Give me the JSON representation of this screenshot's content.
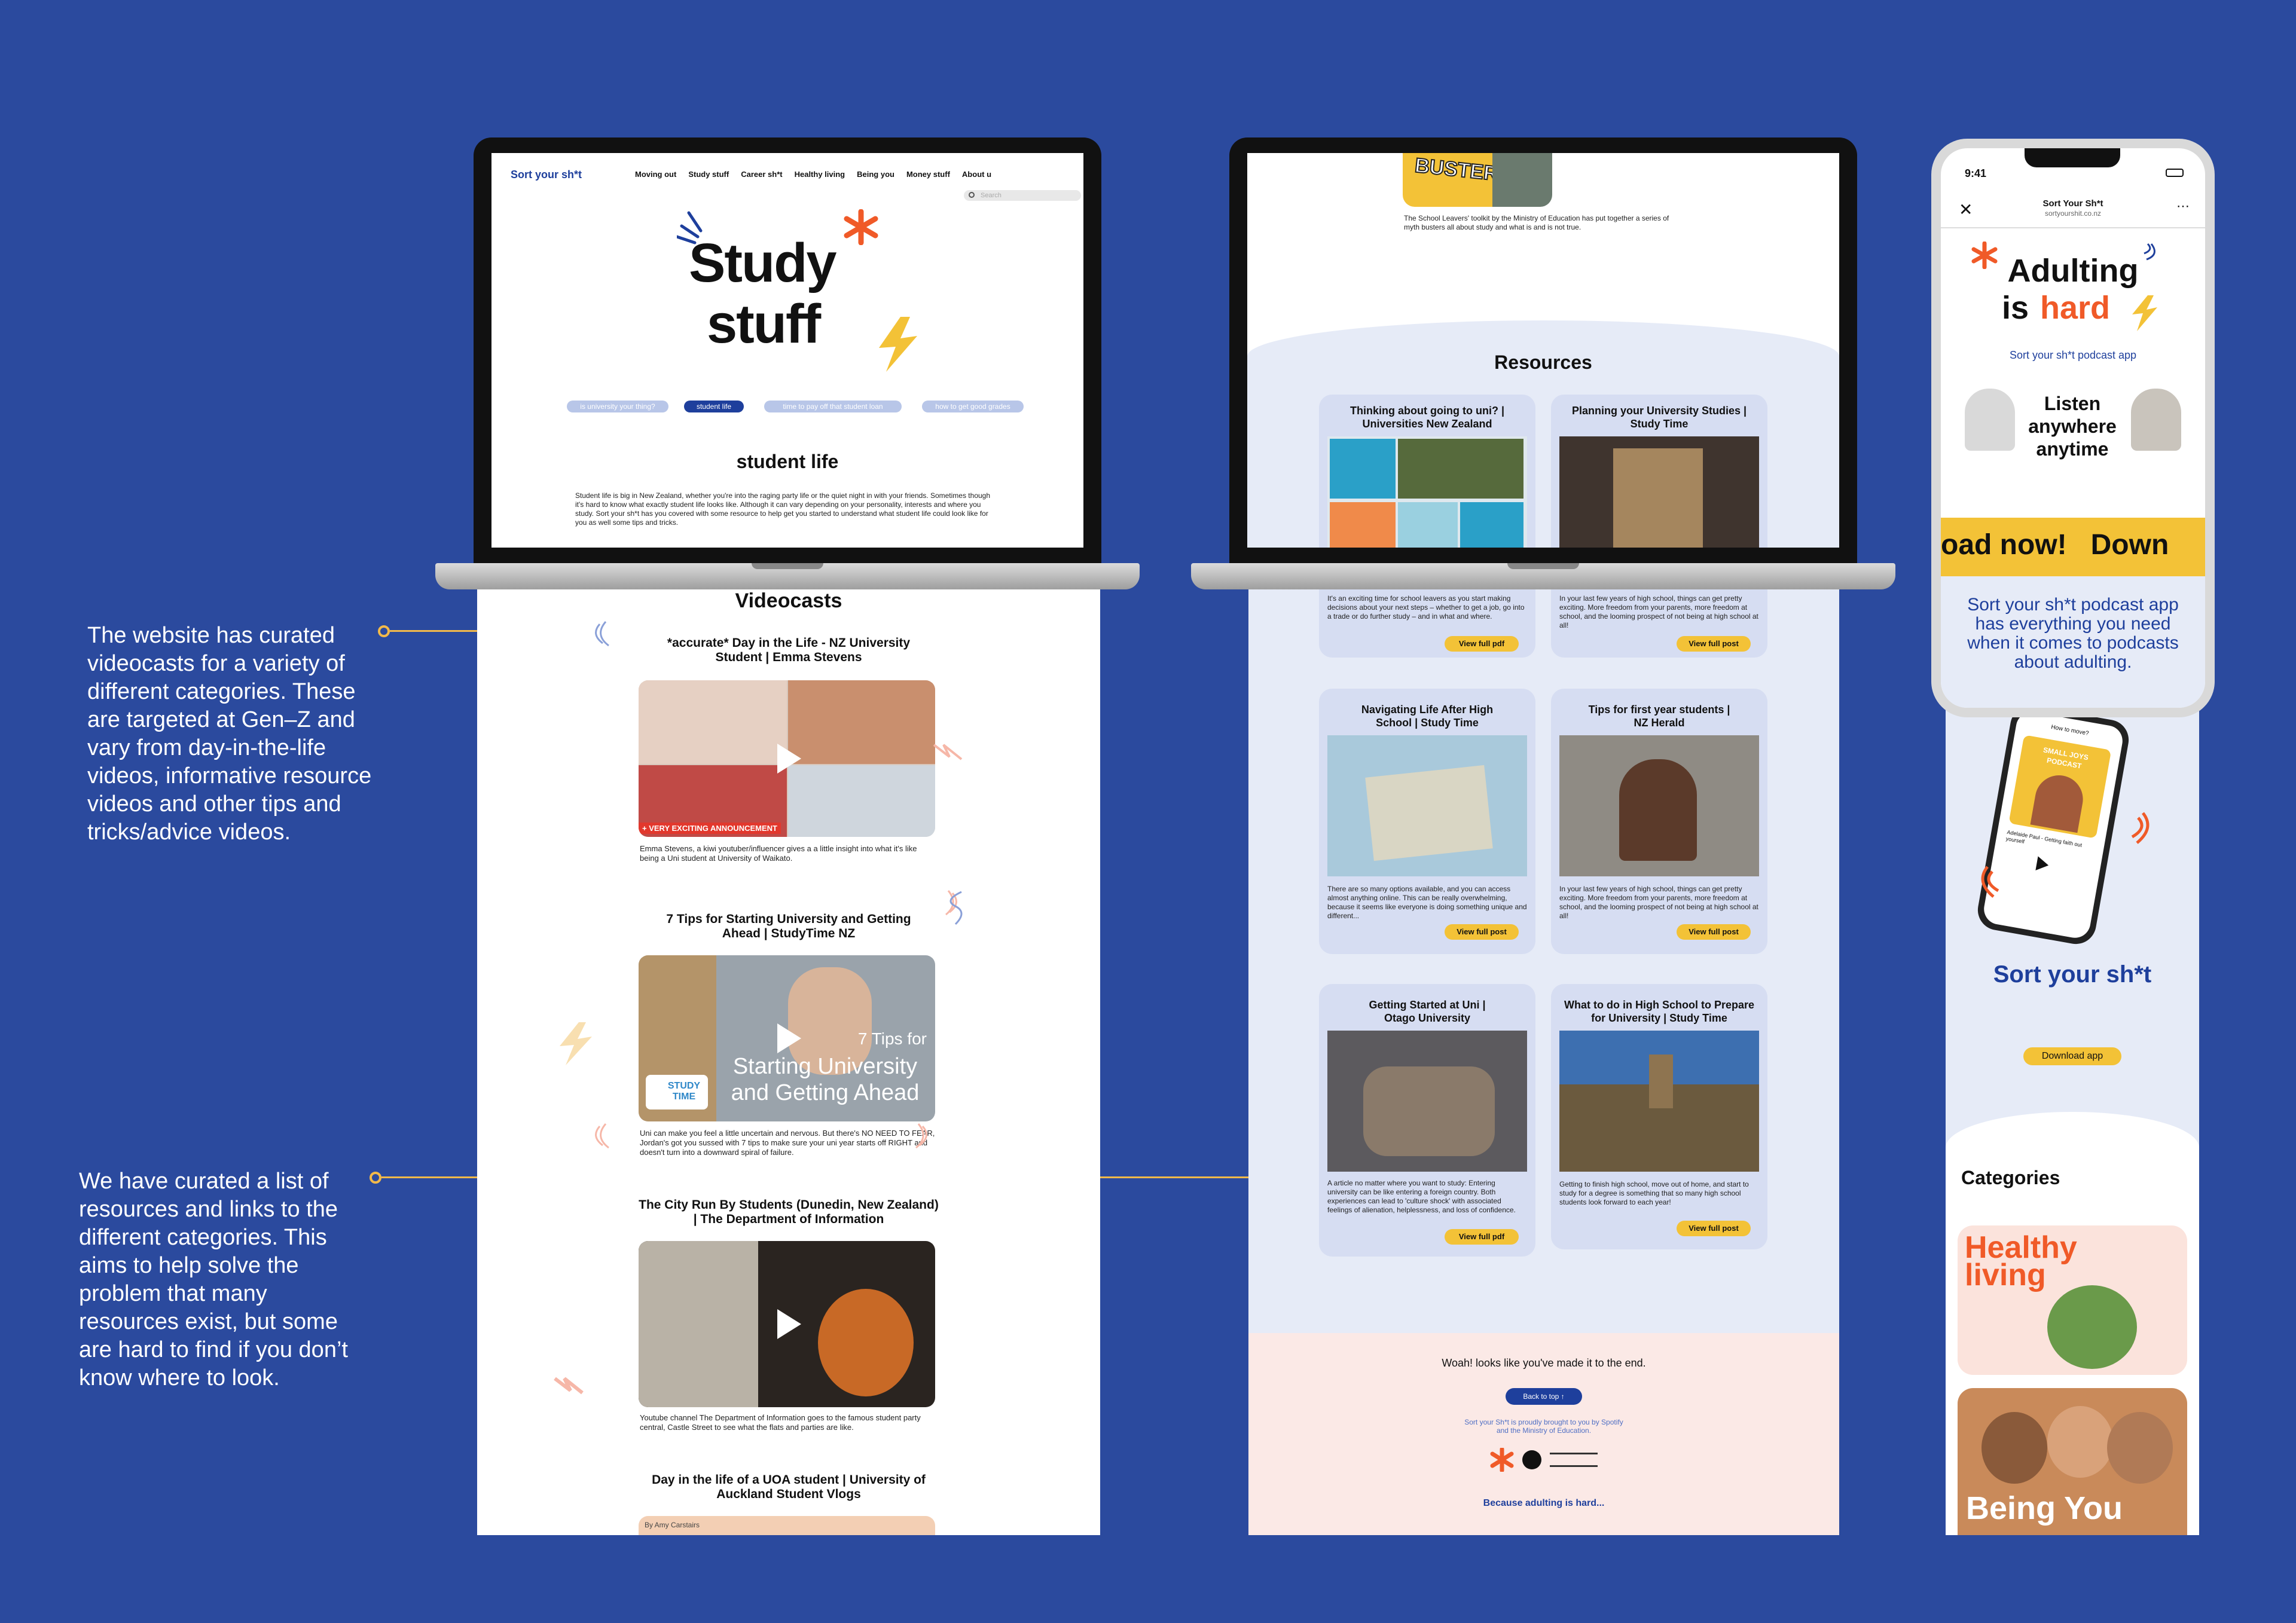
{
  "callouts": {
    "top": "The website has curated videocasts for a variety of different categories. These are targeted at Gen–Z and vary from day-in-the-life videos, informative resource videos and other tips and tricks/advice videos.",
    "bottom": "We have curated a list of resources and links to the different categories. This aims to help solve the problem that many resources exist, but some are hard to find if you don’t know where to look."
  },
  "site1": {
    "logo": "Sort your sh*t",
    "nav": [
      "Moving out",
      "Study stuff",
      "Career sh*t",
      "Healthy living",
      "Being you",
      "Money stuff",
      "About u"
    ],
    "search_placeholder": "Search",
    "hero_line1": "Study",
    "hero_line2": "stuff",
    "pills": [
      "is university your thing?",
      "student life",
      "time to pay off that student loan",
      "how to get good grades"
    ],
    "section_title": "student life",
    "intro": "Student life is big in New Zealand, whether you're into the raging party life or the quiet night in with your friends. Sometimes though it's hard to know what exactly student life looks like. Although it can vary depending on your personality, interests and where you study. Sort your sh*t has you covered with some resource to help get you started to understand what student life could look like for you as well some tips and tricks.",
    "videocasts_title": "Videocasts",
    "videos": [
      {
        "title": "*accurate* Day in the Life - NZ University Student | Emma Stevens",
        "badge": "+ VERY EXCITING ANNOUNCEMENT",
        "desc": "Emma Stevens, a kiwi youtuber/influencer gives a a little insight into what it's like being a Uni student at University of Waikato."
      },
      {
        "title": "7 Tips for Starting University and Getting Ahead | StudyTime NZ",
        "overlay_small": "7 Tips for",
        "overlay_big": "Starting University and Getting Ahead",
        "brand": "STUDY TIME",
        "desc": "Uni can make you feel a little uncertain and nervous. But there's NO NEED TO FEAR, Jordan's got you sussed with 7 tips to make sure your uni year starts off RIGHT and doesn't turn into a downward spiral of failure."
      },
      {
        "title": "The City Run By Students (Dunedin, New Zealand) | The Department of Information",
        "desc": "Youtube channel The Department of Information goes to the famous student party central, Castle Street to see what the flats and parties are like."
      },
      {
        "title": "Day in the life of a UOA student | University of Auckland Student Vlogs",
        "byline": "By Amy Carstairs"
      }
    ]
  },
  "site2": {
    "busters": "BUSTERS",
    "busters_caption": "The School Leavers' toolkit by the Ministry of Education has put together a series of myth busters all about study and what is and is not true.",
    "resources_title": "Resources",
    "cards": [
      {
        "title": "Thinking about going to uni? | Universities New Zealand",
        "desc": "It's an exciting time for school leavers as you start making decisions about your next steps – whether to get a job, go into a trade or do further study – and in what and where.",
        "button": "View full pdf"
      },
      {
        "title": "Planning your University Studies | Study Time",
        "desc": "In your last few years of high school, things can get pretty exciting. More freedom from your parents, more freedom at school, and the looming prospect of not being at high school at all!",
        "button": "View full post"
      },
      {
        "title": "Navigating Life After High School | Study Time",
        "desc": "There are so many options available, and you can access almost anything online. This can be really overwhelming, because it seems like everyone is doing something unique and different...",
        "button": "View full post"
      },
      {
        "title": "Tips for first year students | NZ Herald",
        "desc": "In your last few years of high school, things can get pretty exciting. More freedom from your parents, more freedom at school, and the looming prospect of not being at high school at all!",
        "button": "View full post"
      },
      {
        "title": "Getting Started at Uni | Otago University",
        "desc": "A article no matter where you want to study: Entering university can be like entering a foreign country. Both experiences can lead to 'culture shock' with associated feelings of alienation, helplessness, and loss of confidence.",
        "button": "View full pdf"
      },
      {
        "title": "What to do in High School to Prepare for University | Study Time",
        "desc": "Getting to finish high school, move out of home, and start to study for a degree is something that so many high school students look forward to each year!",
        "button": "View full post"
      }
    ],
    "footer_text": "Woah! looks like you've made it to the end.",
    "back_to_top": "Back to top ↑",
    "credit": "Sort your Sh*t is proudly brought to you by Spotify and the Ministry of Education.",
    "tagline": "Because adulting is hard..."
  },
  "phone": {
    "time": "9:41",
    "page_title": "Sort Your Sh*t",
    "url": "sortyourshit.co.nz",
    "headline1": "Adulting",
    "headline2a": "is",
    "headline2b": "hard",
    "sub": "Sort your sh*t podcast app",
    "listen": "Listen anywhere anytime",
    "ticker": "oad now!   Down",
    "promo": "Sort your sh*t podcast app has everything you need when it comes to podcasts about adulting.",
    "mini_header": "How to move?",
    "mini_card_line1": "SMALL JOYS",
    "mini_card_line2": "PODCAST",
    "mini_track": "Adelaide Paul - Getting faith out yourself",
    "logo": "Sort your sh*t",
    "download": "Download app",
    "categories_title": "Categories",
    "categories": [
      "Healthy living",
      "Being You"
    ]
  },
  "colors": {
    "background": "#2b4a9e",
    "brand_blue": "#1e3f9c",
    "accent_orange": "#f05a28",
    "accent_yellow": "#f3c237",
    "card_blue": "#d6ddf2",
    "footer_pink": "#fbe9e6"
  }
}
